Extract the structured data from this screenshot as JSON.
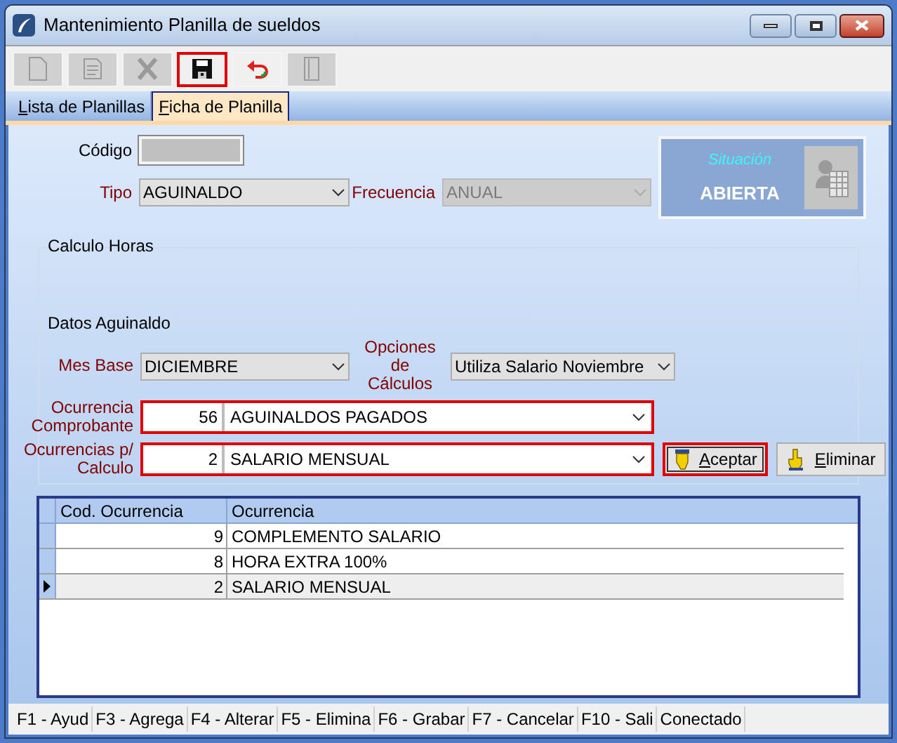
{
  "window": {
    "title": "Mantenimiento Planilla de sueldos"
  },
  "toolbar": [
    {
      "kind": "new",
      "disabled": true,
      "highlighted": false
    },
    {
      "kind": "edit",
      "disabled": true,
      "highlighted": false
    },
    {
      "kind": "delete",
      "disabled": true,
      "highlighted": false
    },
    {
      "kind": "save",
      "disabled": false,
      "highlighted": true
    },
    {
      "kind": "undo",
      "disabled": false,
      "highlighted": false
    },
    {
      "kind": "exit",
      "disabled": true,
      "highlighted": false
    }
  ],
  "tabs": [
    {
      "hotkey": "L",
      "rest": "ista de Planillas",
      "selected": false
    },
    {
      "hotkey": "F",
      "rest": "icha de Planilla",
      "selected": true
    }
  ],
  "codigo": {
    "label": "Código",
    "disabled": true
  },
  "tipo": {
    "label": "Tipo",
    "required": true,
    "value": "AGUINALDO"
  },
  "frecuencia": {
    "label": "Frecuencia",
    "required": true,
    "value": "ANUAL",
    "disabled": true
  },
  "situacion": {
    "caption": "Situación",
    "status": "ABIERTA"
  },
  "calculo_horas": {
    "title": "Calculo Horas"
  },
  "datos_aguinaldo": {
    "title": "Datos Aguinaldo",
    "mes_base": {
      "label": "Mes Base",
      "required": true,
      "value": "DICIEMBRE"
    },
    "opciones": {
      "label": "Opciones de Cálculos",
      "required": true,
      "value": "Utiliza Salario Noviembre"
    },
    "ocurrencia_comprobante": {
      "label": "Ocurrencia Comprobante",
      "required": true,
      "code": "56",
      "value": "AGUINALDOS PAGADOS",
      "highlighted": true
    },
    "ocurrencias_calculo": {
      "label": "Ocurrencias p/ Calculo",
      "required": true,
      "code": "2",
      "value": "SALARIO MENSUAL",
      "highlighted": true
    },
    "buttons": [
      {
        "kind": "accept",
        "hotkey": "A",
        "rest": "ceptar",
        "highlighted": true
      },
      {
        "kind": "delete",
        "hotkey": "E",
        "rest": "liminar",
        "highlighted": false
      }
    ]
  },
  "grid": {
    "columns": [
      "Cod. Ocurrencia",
      "Ocurrencia"
    ],
    "rows": [
      {
        "code": "9",
        "name": "COMPLEMENTO SALARIO",
        "selected": false
      },
      {
        "code": "8",
        "name": "HORA EXTRA 100%",
        "selected": false
      },
      {
        "code": "2",
        "name": "SALARIO MENSUAL",
        "selected": true
      }
    ]
  },
  "status_bar": [
    "F1 - Ayud",
    "F3 - Agrega",
    "F4 - Alterar",
    "F5 - Elimina",
    "F6 - Grabar",
    "F7 - Cancelar",
    "F10 - Sali",
    "Conectado"
  ]
}
